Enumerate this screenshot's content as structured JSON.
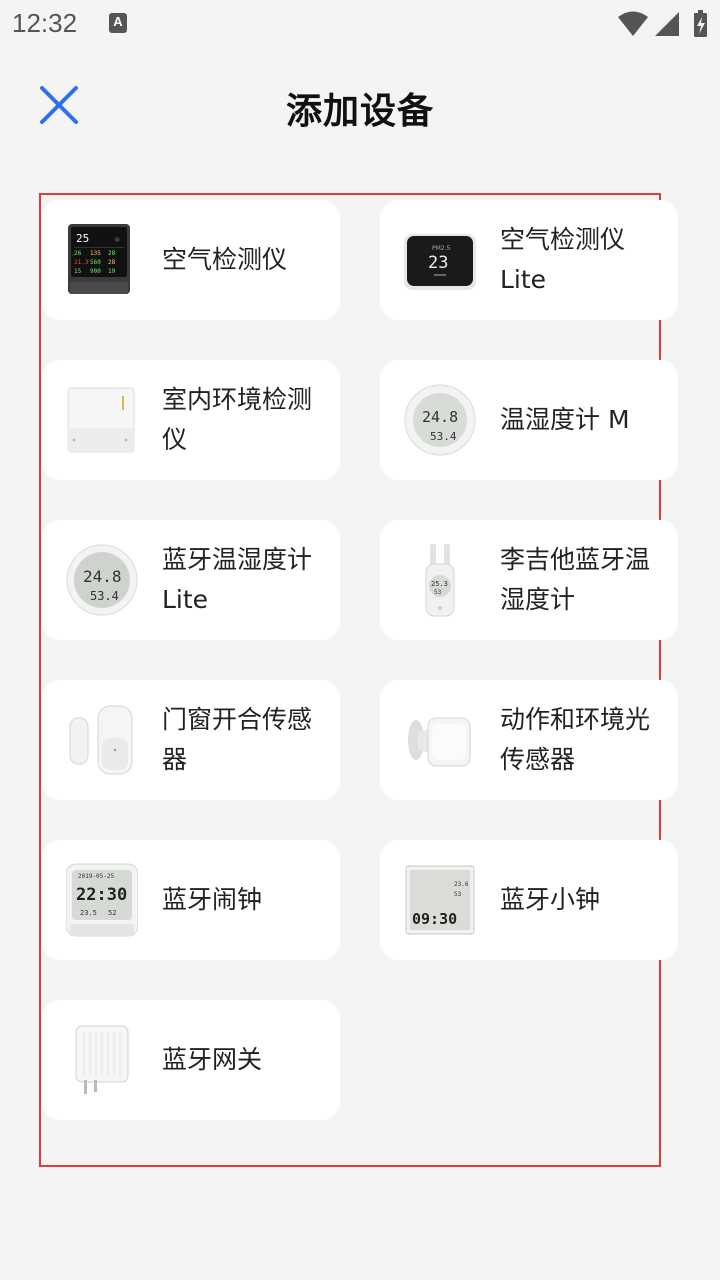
{
  "status_bar": {
    "time": "12:32",
    "notification_icon": "A",
    "icons": [
      "wifi-icon",
      "signal-icon",
      "battery-charging-icon"
    ]
  },
  "header": {
    "title": "添加设备",
    "close_icon": "close-icon",
    "accent_color": "#2f6fe8"
  },
  "frame_color": "#e0393e",
  "devices": [
    {
      "name": "空气检测仪",
      "icon": "air-monitor-icon"
    },
    {
      "name": "空气检测仪 Lite",
      "icon": "air-monitor-lite-icon"
    },
    {
      "name": "室内环境检测仪",
      "icon": "indoor-environment-monitor-icon"
    },
    {
      "name": "温湿度计 M",
      "icon": "thermo-hygrometer-m-icon"
    },
    {
      "name": "蓝牙温湿度计 Lite",
      "icon": "bluetooth-thermo-hygrometer-lite-icon"
    },
    {
      "name": "李吉他蓝牙温湿度计",
      "icon": "lee-guitar-thermo-hygrometer-icon"
    },
    {
      "name": "门窗开合传感器",
      "icon": "door-window-sensor-icon"
    },
    {
      "name": "动作和环境光传感器",
      "icon": "motion-light-sensor-icon"
    },
    {
      "name": "蓝牙闹钟",
      "icon": "bluetooth-alarm-clock-icon"
    },
    {
      "name": "蓝牙小钟",
      "icon": "bluetooth-small-clock-icon"
    },
    {
      "name": "蓝牙网关",
      "icon": "bluetooth-gateway-icon"
    }
  ],
  "device_readouts": {
    "air_monitor": {
      "temp": "25",
      "row1": [
        "26",
        "135",
        "28"
      ],
      "row2": [
        "21.3",
        "560",
        "28"
      ],
      "row3": [
        "15",
        "900",
        "19"
      ]
    },
    "air_monitor_lite": {
      "label": "PM2.5",
      "value": "23"
    },
    "thermo_m": {
      "temp": "24.8",
      "humidity": "53.4"
    },
    "thermo_lite": {
      "temp": "24.8",
      "humidity": "53.4"
    },
    "lee_guitar": {
      "temp": "25.3",
      "humidity": "53"
    },
    "alarm_clock": {
      "date": "2019-05-25",
      "time": "22:30",
      "temp": "23.5",
      "humidity": "52"
    },
    "small_clock": {
      "time": "09:30",
      "temp": "23.6",
      "humidity": "53"
    }
  }
}
